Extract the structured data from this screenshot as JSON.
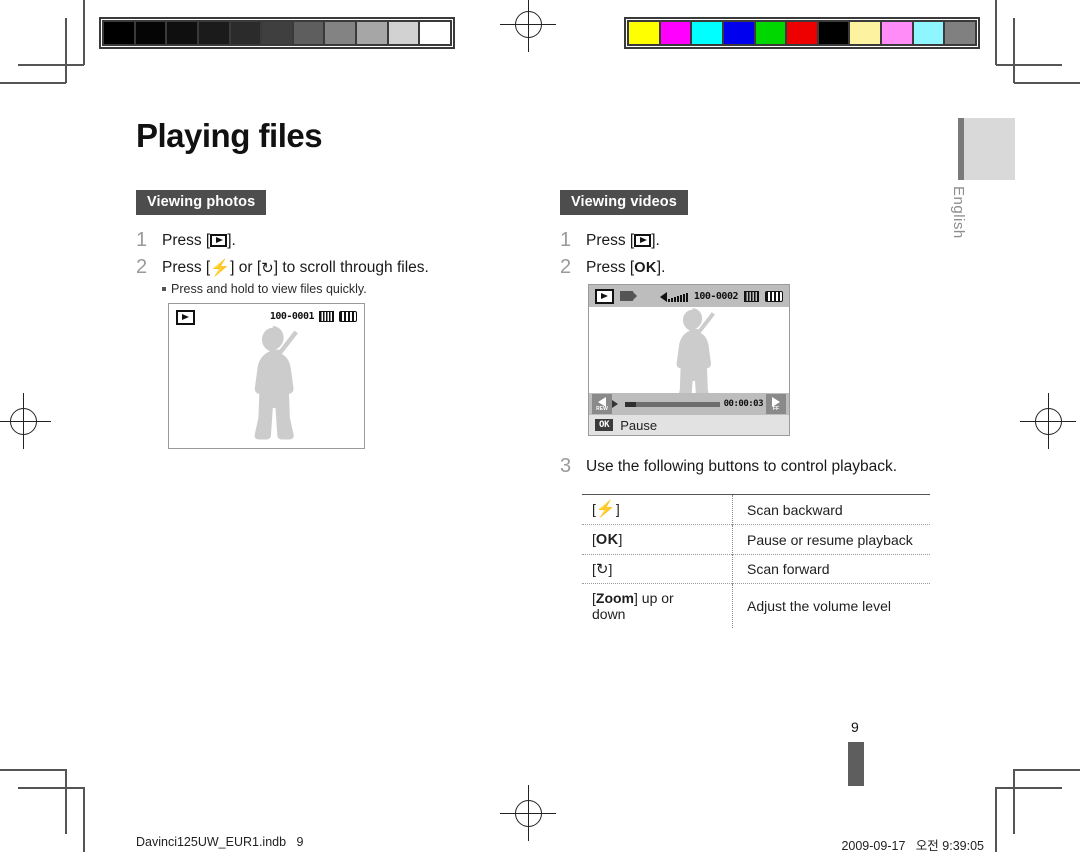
{
  "page": {
    "title": "Playing files",
    "side_tab_label": "English",
    "page_number": "9"
  },
  "footer": {
    "file_name": "Davinci125UW_EUR1.indb   9",
    "timestamp": "2009-09-17   오전 9:39:05"
  },
  "calibration": {
    "grayscale_name": "grayscale-bar",
    "grayscale": [
      "#000000",
      "#050505",
      "#0f0f0f",
      "#1b1b1b",
      "#2b2b2b",
      "#3f3f3f",
      "#5e5e5e",
      "#838383",
      "#a6a6a6",
      "#d2d2d2",
      "#ffffff"
    ],
    "color_name": "color-bar",
    "colors": [
      "#ffff00",
      "#ff00ff",
      "#00ffff",
      "#0000ee",
      "#00d700",
      "#ee0000",
      "#000000",
      "#fdf2a0",
      "#ff8cf7",
      "#8ff6ff",
      "#808080"
    ]
  },
  "left_column": {
    "section_label": "Viewing photos",
    "steps": [
      {
        "num": "1",
        "before": "Press [",
        "icon": "play-button-icon",
        "after": "]."
      },
      {
        "num": "2",
        "before": "Press [",
        "icon": "flash-button-icon",
        "middle": "] or [",
        "icon2": "self-timer-button-icon",
        "after": "] to scroll through files."
      }
    ],
    "sub_note": "Press and hold to view files quickly.",
    "screen": {
      "name": "photo-playback-screen",
      "file_number": "100-0001",
      "icons": [
        "play-mode-icon",
        "memory-card-icon",
        "battery-icon"
      ]
    }
  },
  "right_column": {
    "section_label": "Viewing videos",
    "steps": [
      {
        "num": "1",
        "before": "Press [",
        "icon": "play-button-icon",
        "after": "]."
      },
      {
        "num": "2",
        "before": "Press [",
        "ok": "OK",
        "after": "]."
      }
    ],
    "screen": {
      "name": "video-playback-screen",
      "file_number": "100-0002",
      "elapsed_time": "00:00:03",
      "hint_key": "OK",
      "hint_label": "Pause",
      "rew_label": "REW",
      "ff_label": "FF",
      "icons": [
        "play-mode-icon",
        "video-clip-icon",
        "volume-icon",
        "memory-card-icon",
        "battery-icon"
      ],
      "progress_percent": 12
    },
    "step3": {
      "num": "3",
      "text": "Use the following buttons to control playback."
    },
    "control_table": {
      "rows": [
        {
          "key_icon": "flash-button-icon",
          "key_text": "[⚡]",
          "action": "Scan backward"
        },
        {
          "key_icon": "ok-button-icon",
          "key_text": "[OK]",
          "action": "Pause or resume playback"
        },
        {
          "key_icon": "self-timer-button-icon",
          "key_text": "[↻]",
          "action": "Scan forward"
        },
        {
          "key_icon": "zoom-button-icon",
          "key_text": "[Zoom] up or down",
          "key_bold": "Zoom",
          "key_rest": "] up or",
          "key_line2": "down",
          "action": "Adjust the volume level"
        }
      ]
    }
  }
}
